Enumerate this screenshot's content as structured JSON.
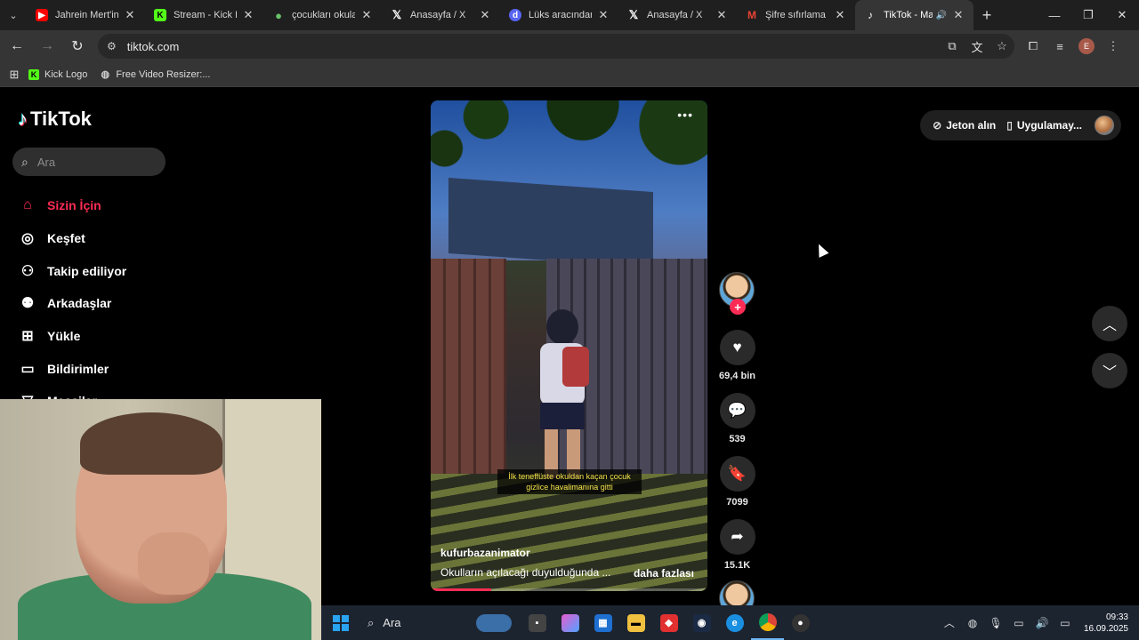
{
  "browser": {
    "tabs": [
      {
        "title": "Jahrein Mert'in H",
        "icon": "youtube-icon",
        "color": "#ff0000"
      },
      {
        "title": "Stream - Kick Da",
        "icon": "kick-icon",
        "color": "#53fc18"
      },
      {
        "title": "çocukları okula g",
        "icon": "drop-icon",
        "color": "#6ac26a"
      },
      {
        "title": "Anasayfa / X",
        "icon": "x-icon",
        "color": "#ffffff"
      },
      {
        "title": "Lüks aracından in",
        "icon": "discord-icon",
        "color": "#5865f2"
      },
      {
        "title": "Anasayfa / X",
        "icon": "x-icon",
        "color": "#ffffff"
      },
      {
        "title": "Şifre sıfırlama ist",
        "icon": "gmail-icon",
        "color": "#ea4335"
      },
      {
        "title": "TikTok - Mak",
        "icon": "tiktok-icon",
        "color": "#ffffff",
        "active": true
      }
    ],
    "url": "tiktok.com",
    "profile_initial": "E",
    "bookmarks": [
      {
        "label": "Kick Logo",
        "icon": "kick-icon",
        "color": "#53fc18"
      },
      {
        "label": "Free Video Resizer:...",
        "icon": "globe-icon",
        "color": "#cccccc"
      }
    ]
  },
  "tiktok": {
    "logo_text": "TikTok",
    "search_placeholder": "Ara",
    "menu": [
      {
        "label": "Sizin İçin",
        "icon": "home-icon",
        "active": true
      },
      {
        "label": "Keşfet",
        "icon": "compass-icon"
      },
      {
        "label": "Takip ediliyor",
        "icon": "following-icon"
      },
      {
        "label": "Arkadaşlar",
        "icon": "friends-icon"
      },
      {
        "label": "Yükle",
        "icon": "upload-icon"
      },
      {
        "label": "Bildirimler",
        "icon": "notifications-icon"
      },
      {
        "label": "Mesajlar",
        "icon": "messages-icon"
      }
    ],
    "top_actions": {
      "coins": "Jeton alın",
      "app": "Uygulamay..."
    },
    "video": {
      "caption_line1": "İlk teneffüste okuldan kaçan çocuk",
      "caption_line2": "gizlice havalimanına gitti",
      "author": "kufurbazanimator",
      "description": "Okulların açılacağı duyulduğunda ...",
      "more_link": "daha fazlası",
      "progress": 0.22
    },
    "stats": {
      "likes": "69,4 bin",
      "comments": "539",
      "saves": "7099",
      "shares": "15.1K"
    }
  },
  "taskbar": {
    "search_placeholder": "Ara",
    "time": "09:33",
    "date": "16.09.2025"
  },
  "colors": {
    "tiktok_accent": "#fe2c55",
    "browser_bg": "#1f1f1f",
    "toolbar_bg": "#353535"
  }
}
